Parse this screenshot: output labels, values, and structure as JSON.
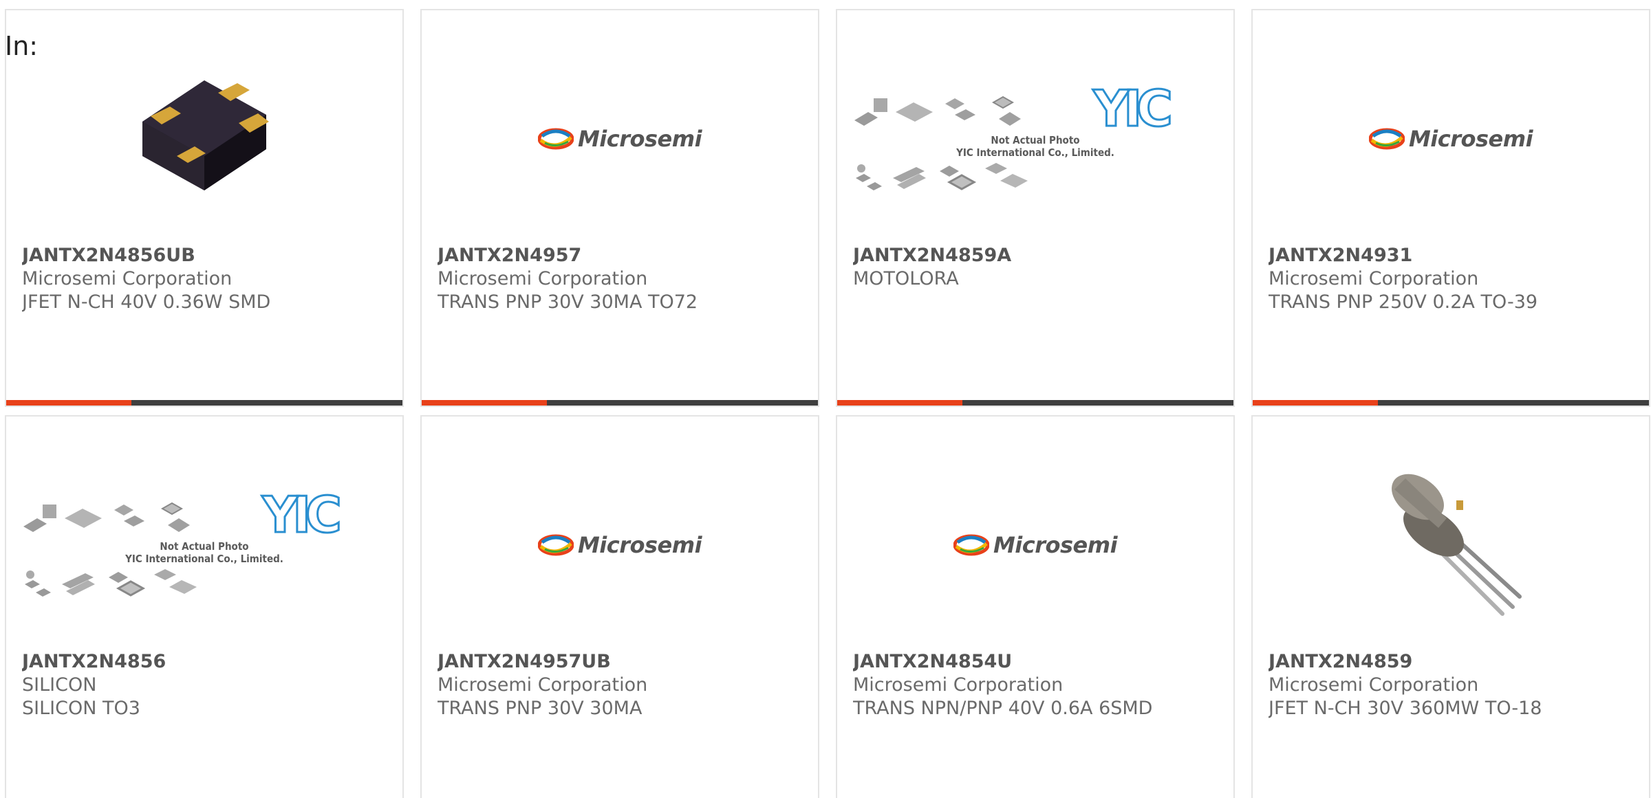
{
  "header": {
    "in_label": "In:"
  },
  "logo": {
    "microsemi_text": "Microsemi",
    "yic_letters": "YIC",
    "yic_line1": "Not Actual Photo",
    "yic_line2": "YIC International Co., Limited."
  },
  "colors": {
    "accent": "#e8411a",
    "bar_dark": "#3f3f3f",
    "card_border": "#e4e4e4",
    "text_gray": "#6a6a6a"
  },
  "products": [
    {
      "part": "JANTX2N4856UB",
      "maker": "Microsemi Corporation",
      "desc": "JFET N-CH 40V 0.36W SMD",
      "image": "smd-package-photo"
    },
    {
      "part": "JANTX2N4957",
      "maker": "Microsemi Corporation",
      "desc": "TRANS PNP 30V 30MA TO72",
      "image": "microsemi-logo"
    },
    {
      "part": "JANTX2N4859A",
      "maker": "MOTOLORA",
      "desc": "",
      "image": "yic-placeholder"
    },
    {
      "part": "JANTX2N4931",
      "maker": "Microsemi Corporation",
      "desc": "TRANS PNP 250V 0.2A TO-39",
      "image": "microsemi-logo"
    },
    {
      "part": "JANTX2N4856",
      "maker": "SILICON",
      "desc": "SILICON TO3",
      "image": "yic-placeholder"
    },
    {
      "part": "JANTX2N4957UB",
      "maker": "Microsemi Corporation",
      "desc": "TRANS PNP 30V 30MA",
      "image": "microsemi-logo"
    },
    {
      "part": "JANTX2N4854U",
      "maker": "Microsemi Corporation",
      "desc": "TRANS NPN/PNP 40V 0.6A 6SMD",
      "image": "microsemi-logo"
    },
    {
      "part": "JANTX2N4859",
      "maker": "Microsemi Corporation",
      "desc": "JFET N-CH 30V 360MW TO-18",
      "image": "to18-transistor-photo"
    }
  ]
}
